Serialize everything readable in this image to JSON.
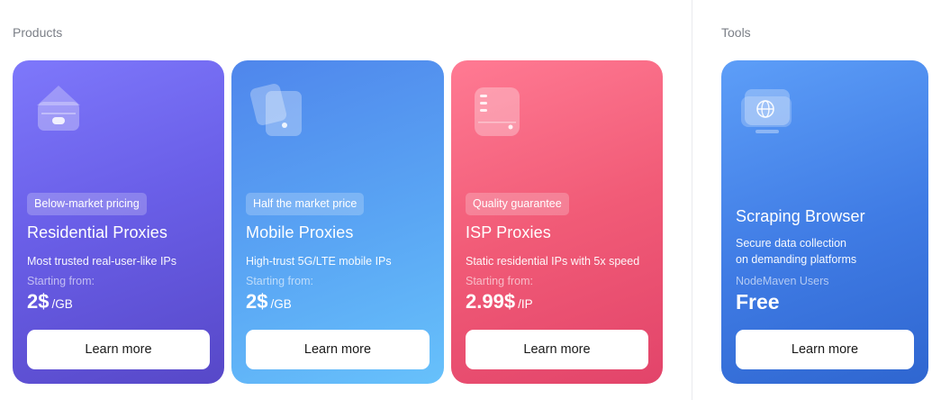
{
  "sections": {
    "products": "Products",
    "tools": "Tools"
  },
  "cards": [
    {
      "icon": "home-icon",
      "badge": "Below-market pricing",
      "title": "Residential Proxies",
      "desc": "Most trusted real-user-like IPs",
      "start_label": "Starting from:",
      "price": "2$",
      "unit": "/GB",
      "button": "Learn more"
    },
    {
      "icon": "mobile-icon",
      "badge": "Half the market price",
      "title": "Mobile Proxies",
      "desc": "High-trust 5G/LTE mobile IPs",
      "start_label": "Starting from:",
      "price": "2$",
      "unit": "/GB",
      "button": "Learn more"
    },
    {
      "icon": "server-icon",
      "badge": "Quality guarantee",
      "title": "ISP Proxies",
      "desc": "Static residential IPs with 5x speed",
      "start_label": "Starting from:",
      "price": "2.99$",
      "unit": "/IP",
      "button": "Learn more"
    },
    {
      "icon": "globe-monitor-icon",
      "title": "Scraping Browser",
      "desc_line1": "Secure data collection",
      "desc_line2": "on demanding platforms",
      "start_label": "NodeMaven Users",
      "price": "Free",
      "button": "Learn more"
    }
  ]
}
